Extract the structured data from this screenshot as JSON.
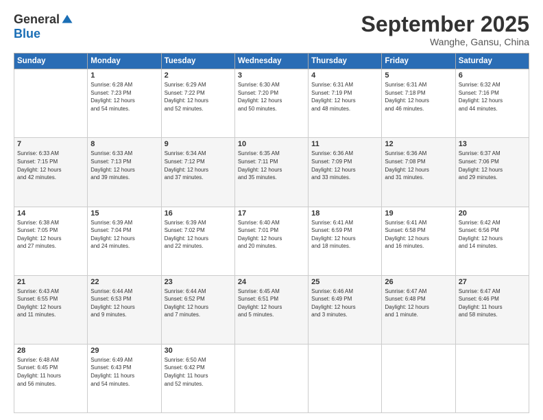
{
  "header": {
    "logo_general": "General",
    "logo_blue": "Blue",
    "month": "September 2025",
    "location": "Wanghe, Gansu, China"
  },
  "days_of_week": [
    "Sunday",
    "Monday",
    "Tuesday",
    "Wednesday",
    "Thursday",
    "Friday",
    "Saturday"
  ],
  "weeks": [
    [
      {
        "day": "",
        "info": ""
      },
      {
        "day": "1",
        "info": "Sunrise: 6:28 AM\nSunset: 7:23 PM\nDaylight: 12 hours\nand 54 minutes."
      },
      {
        "day": "2",
        "info": "Sunrise: 6:29 AM\nSunset: 7:22 PM\nDaylight: 12 hours\nand 52 minutes."
      },
      {
        "day": "3",
        "info": "Sunrise: 6:30 AM\nSunset: 7:20 PM\nDaylight: 12 hours\nand 50 minutes."
      },
      {
        "day": "4",
        "info": "Sunrise: 6:31 AM\nSunset: 7:19 PM\nDaylight: 12 hours\nand 48 minutes."
      },
      {
        "day": "5",
        "info": "Sunrise: 6:31 AM\nSunset: 7:18 PM\nDaylight: 12 hours\nand 46 minutes."
      },
      {
        "day": "6",
        "info": "Sunrise: 6:32 AM\nSunset: 7:16 PM\nDaylight: 12 hours\nand 44 minutes."
      }
    ],
    [
      {
        "day": "7",
        "info": "Sunrise: 6:33 AM\nSunset: 7:15 PM\nDaylight: 12 hours\nand 42 minutes."
      },
      {
        "day": "8",
        "info": "Sunrise: 6:33 AM\nSunset: 7:13 PM\nDaylight: 12 hours\nand 39 minutes."
      },
      {
        "day": "9",
        "info": "Sunrise: 6:34 AM\nSunset: 7:12 PM\nDaylight: 12 hours\nand 37 minutes."
      },
      {
        "day": "10",
        "info": "Sunrise: 6:35 AM\nSunset: 7:11 PM\nDaylight: 12 hours\nand 35 minutes."
      },
      {
        "day": "11",
        "info": "Sunrise: 6:36 AM\nSunset: 7:09 PM\nDaylight: 12 hours\nand 33 minutes."
      },
      {
        "day": "12",
        "info": "Sunrise: 6:36 AM\nSunset: 7:08 PM\nDaylight: 12 hours\nand 31 minutes."
      },
      {
        "day": "13",
        "info": "Sunrise: 6:37 AM\nSunset: 7:06 PM\nDaylight: 12 hours\nand 29 minutes."
      }
    ],
    [
      {
        "day": "14",
        "info": "Sunrise: 6:38 AM\nSunset: 7:05 PM\nDaylight: 12 hours\nand 27 minutes."
      },
      {
        "day": "15",
        "info": "Sunrise: 6:39 AM\nSunset: 7:04 PM\nDaylight: 12 hours\nand 24 minutes."
      },
      {
        "day": "16",
        "info": "Sunrise: 6:39 AM\nSunset: 7:02 PM\nDaylight: 12 hours\nand 22 minutes."
      },
      {
        "day": "17",
        "info": "Sunrise: 6:40 AM\nSunset: 7:01 PM\nDaylight: 12 hours\nand 20 minutes."
      },
      {
        "day": "18",
        "info": "Sunrise: 6:41 AM\nSunset: 6:59 PM\nDaylight: 12 hours\nand 18 minutes."
      },
      {
        "day": "19",
        "info": "Sunrise: 6:41 AM\nSunset: 6:58 PM\nDaylight: 12 hours\nand 16 minutes."
      },
      {
        "day": "20",
        "info": "Sunrise: 6:42 AM\nSunset: 6:56 PM\nDaylight: 12 hours\nand 14 minutes."
      }
    ],
    [
      {
        "day": "21",
        "info": "Sunrise: 6:43 AM\nSunset: 6:55 PM\nDaylight: 12 hours\nand 11 minutes."
      },
      {
        "day": "22",
        "info": "Sunrise: 6:44 AM\nSunset: 6:53 PM\nDaylight: 12 hours\nand 9 minutes."
      },
      {
        "day": "23",
        "info": "Sunrise: 6:44 AM\nSunset: 6:52 PM\nDaylight: 12 hours\nand 7 minutes."
      },
      {
        "day": "24",
        "info": "Sunrise: 6:45 AM\nSunset: 6:51 PM\nDaylight: 12 hours\nand 5 minutes."
      },
      {
        "day": "25",
        "info": "Sunrise: 6:46 AM\nSunset: 6:49 PM\nDaylight: 12 hours\nand 3 minutes."
      },
      {
        "day": "26",
        "info": "Sunrise: 6:47 AM\nSunset: 6:48 PM\nDaylight: 12 hours\nand 1 minute."
      },
      {
        "day": "27",
        "info": "Sunrise: 6:47 AM\nSunset: 6:46 PM\nDaylight: 11 hours\nand 58 minutes."
      }
    ],
    [
      {
        "day": "28",
        "info": "Sunrise: 6:48 AM\nSunset: 6:45 PM\nDaylight: 11 hours\nand 56 minutes."
      },
      {
        "day": "29",
        "info": "Sunrise: 6:49 AM\nSunset: 6:43 PM\nDaylight: 11 hours\nand 54 minutes."
      },
      {
        "day": "30",
        "info": "Sunrise: 6:50 AM\nSunset: 6:42 PM\nDaylight: 11 hours\nand 52 minutes."
      },
      {
        "day": "",
        "info": ""
      },
      {
        "day": "",
        "info": ""
      },
      {
        "day": "",
        "info": ""
      },
      {
        "day": "",
        "info": ""
      }
    ]
  ]
}
